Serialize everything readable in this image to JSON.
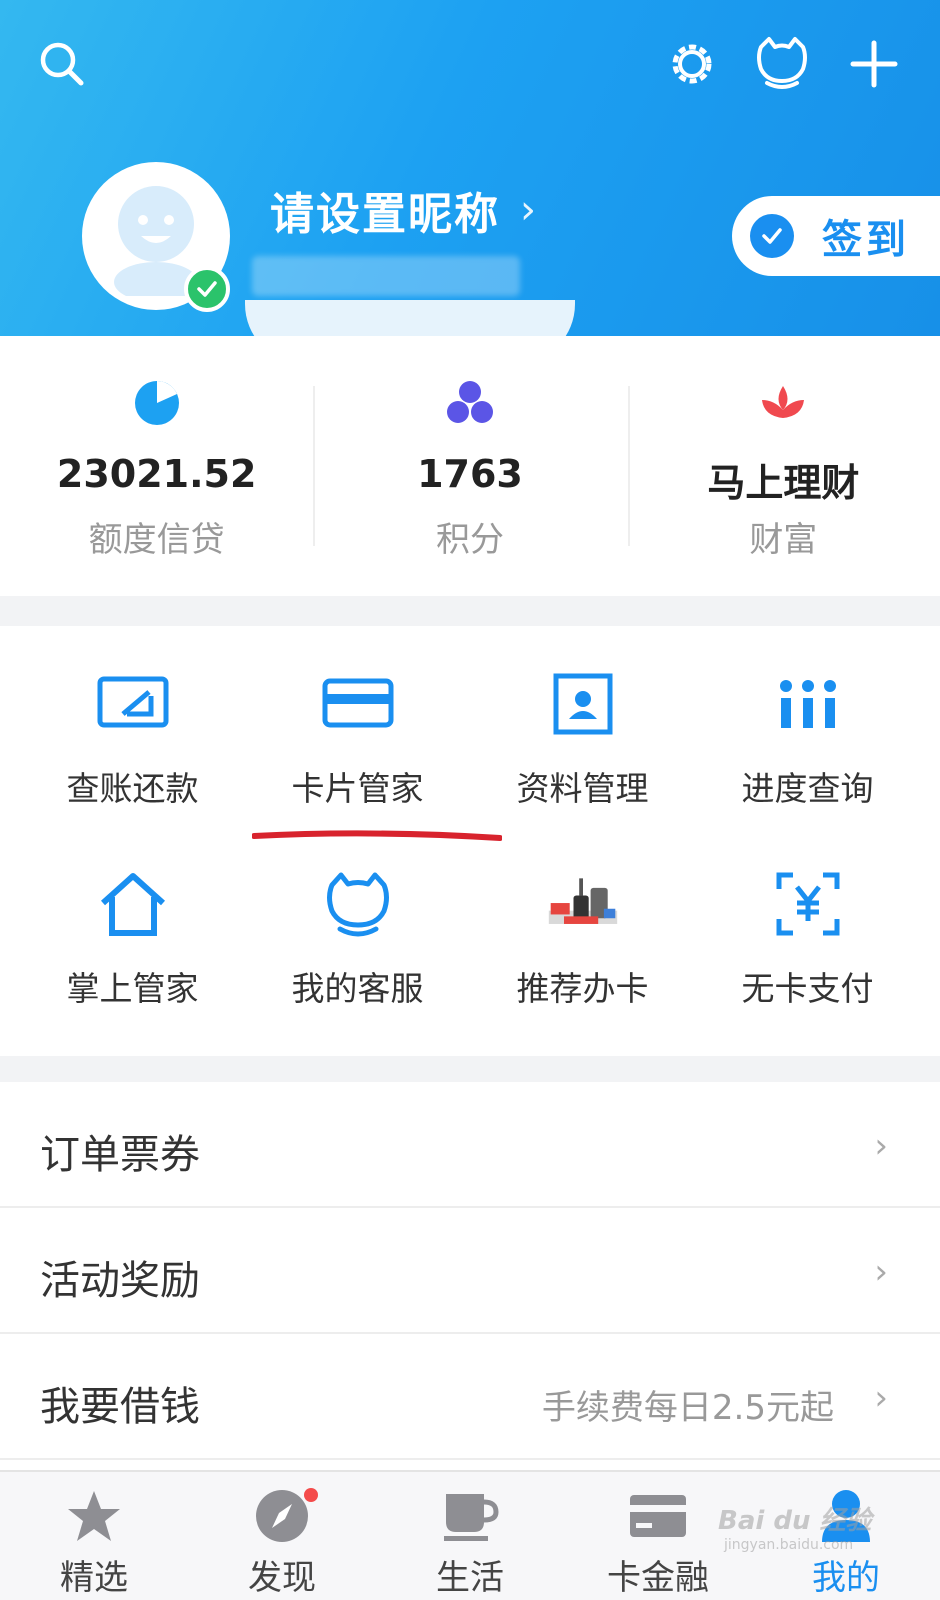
{
  "header": {
    "nickname": "请设置昵称",
    "signin_label": "签到",
    "icons": [
      "search-icon",
      "settings-icon",
      "service-mascot-icon",
      "add-icon"
    ],
    "gradient_colors": [
      "#34b8f0",
      "#1790e8"
    ]
  },
  "stats": [
    {
      "value": "23021.52",
      "label": "额度信贷",
      "icon": "pie-icon",
      "color": "#1da1f2"
    },
    {
      "value": "1763",
      "label": "积分",
      "icon": "three-dots-icon",
      "color": "#5b55e6"
    },
    {
      "value": "马上理财",
      "label": "财富",
      "icon": "lotus-icon",
      "color": "#f0494f"
    }
  ],
  "grid": [
    {
      "label": "查账还款",
      "icon": "bill-repay-icon"
    },
    {
      "label": "卡片管家",
      "icon": "card-icon"
    },
    {
      "label": "资料管理",
      "icon": "profile-icon"
    },
    {
      "label": "进度查询",
      "icon": "progress-icon"
    },
    {
      "label": "掌上管家",
      "icon": "home-icon"
    },
    {
      "label": "我的客服",
      "icon": "customer-service-icon"
    },
    {
      "label": "推荐办卡",
      "icon": "recommend-card-icon"
    },
    {
      "label": "无卡支付",
      "icon": "cardless-pay-icon"
    }
  ],
  "list": [
    {
      "title": "订单票券",
      "note": ""
    },
    {
      "title": "活动奖励",
      "note": ""
    },
    {
      "title": "我要借钱",
      "note": "手续费每日2.5元起"
    }
  ],
  "tabs": [
    {
      "label": "精选",
      "icon": "star-icon",
      "active": false
    },
    {
      "label": "发现",
      "icon": "compass-icon",
      "active": false
    },
    {
      "label": "生活",
      "icon": "cup-icon",
      "active": false
    },
    {
      "label": "卡金融",
      "icon": "card-finance-icon",
      "active": false
    },
    {
      "label": "我的",
      "icon": "person-icon",
      "active": true
    }
  ],
  "accent_color": "#1a8ff0",
  "watermark": {
    "main": "Bai du 经验",
    "sub": "jingyan.baidu.com"
  }
}
